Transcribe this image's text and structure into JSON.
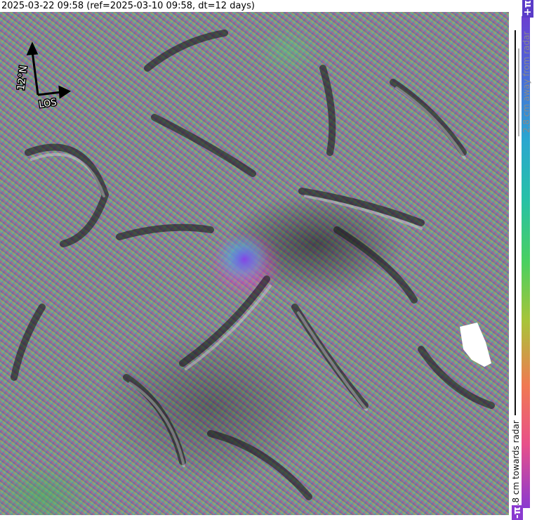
{
  "title": "2025-03-22 09:58 (ref=2025-03-10 09:58, dt=12 days)",
  "compass": {
    "north_label": "12°N",
    "los_label": "LOS"
  },
  "colorbar": {
    "top_label": "+π",
    "top_description": "2.8 cm away from radar",
    "bottom_label": "-π",
    "bottom_description": "2.8 cm towards radar"
  }
}
